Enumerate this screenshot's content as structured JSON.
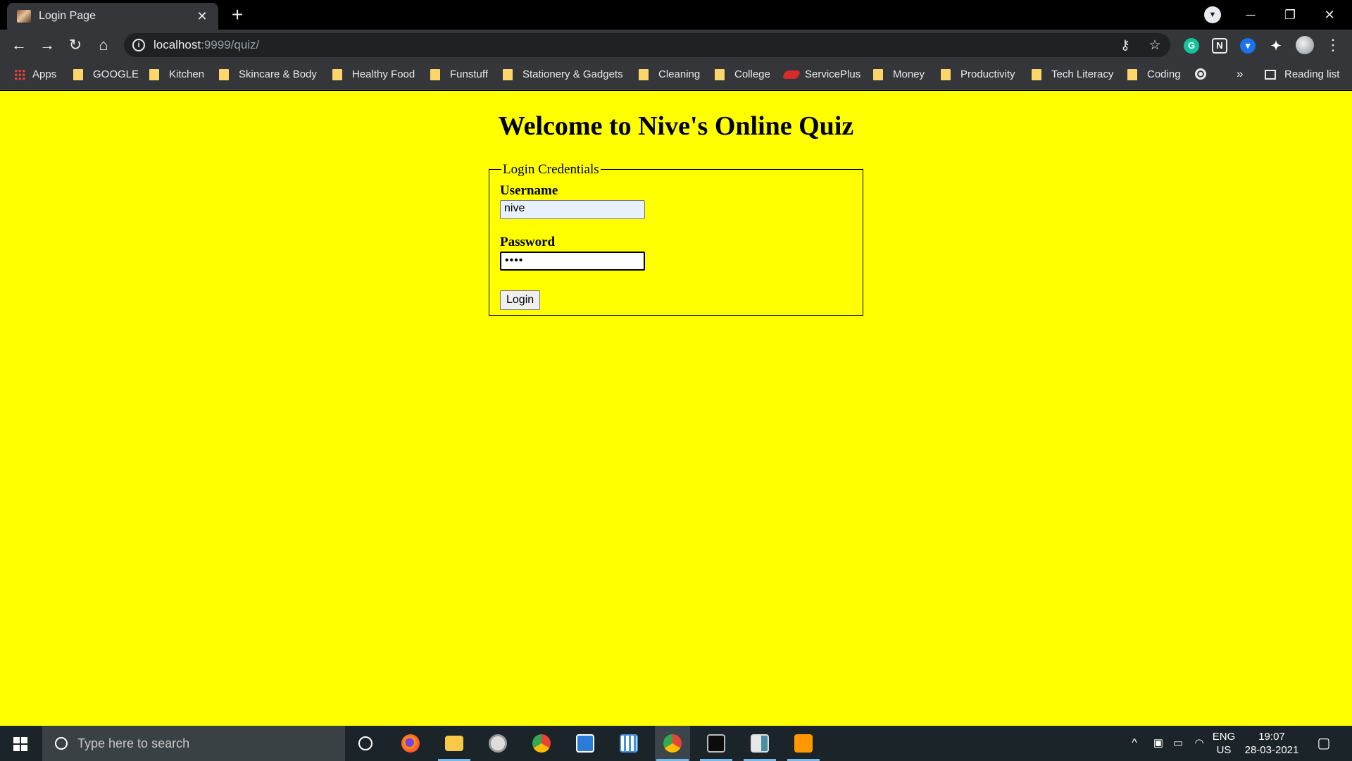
{
  "browser": {
    "tab_title": "Login Page",
    "tab_close": "✕",
    "new_tab": "+",
    "url_host": "localhost",
    "url_rest": ":9999/quiz/",
    "window_controls": {
      "minimize": "─",
      "restore": "❐",
      "close": "✕"
    }
  },
  "bookmarks": {
    "apps": "Apps",
    "items": [
      "GOOGLE",
      "Kitchen",
      "Skincare & Body",
      "Healthy Food",
      "Funstuff",
      "Stationery & Gadgets",
      "Cleaning",
      "College"
    ],
    "serviceplus": "ServicePlus",
    "items2": [
      "Money",
      "Productivity",
      "Tech Literacy",
      "Coding"
    ],
    "overflow": "»",
    "reading_list": "Reading list"
  },
  "page": {
    "heading": "Welcome to Nive's Online Quiz",
    "legend": "Login Credentials",
    "username_label": "Username",
    "username_value": "nive",
    "password_label": "Password",
    "password_value": "••••",
    "login_button": "Login",
    "background_color": "#ffff00"
  },
  "taskbar": {
    "search_placeholder": "Type here to search",
    "lang_top": "ENG",
    "lang_bottom": "US",
    "time": "19:07",
    "date": "28-03-2021"
  }
}
